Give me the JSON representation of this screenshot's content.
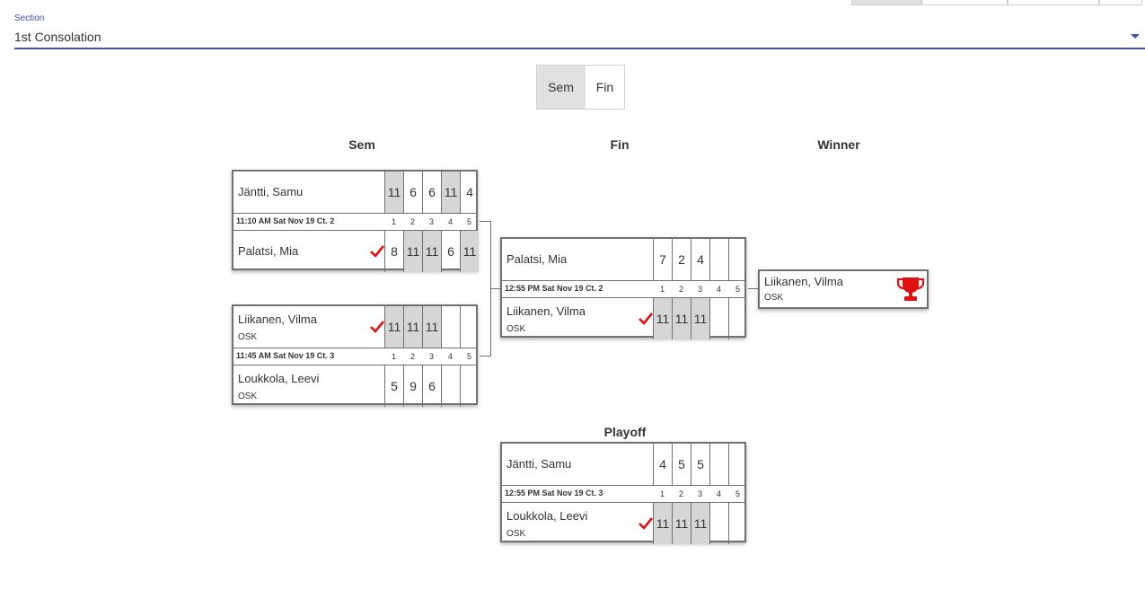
{
  "section": {
    "label": "Section",
    "value": "1st Consolation"
  },
  "round_toggle": [
    {
      "label": "Sem",
      "selected": true
    },
    {
      "label": "Fin",
      "selected": false
    }
  ],
  "headings": {
    "sem": "Sem",
    "fin": "Fin",
    "winner": "Winner",
    "playoff": "Playoff"
  },
  "game_numbers": [
    "1",
    "2",
    "3",
    "4",
    "5"
  ],
  "matches": {
    "sem1": {
      "time": "11:10 AM Sat Nov 19 Ct. 2",
      "p1": {
        "name": "Jäntti, Samu",
        "club": "",
        "won": false,
        "scores": [
          "11",
          "6",
          "6",
          "11",
          "4"
        ],
        "wins": [
          true,
          false,
          false,
          true,
          false
        ]
      },
      "p2": {
        "name": "Palatsi, Mia",
        "club": "",
        "won": true,
        "scores": [
          "8",
          "11",
          "11",
          "6",
          "11"
        ],
        "wins": [
          false,
          true,
          true,
          false,
          true
        ]
      }
    },
    "sem2": {
      "time": "11:45 AM Sat Nov 19 Ct. 3",
      "p1": {
        "name": "Liikanen, Vilma",
        "club": "OSK",
        "won": true,
        "scores": [
          "11",
          "11",
          "11",
          "",
          ""
        ],
        "wins": [
          true,
          true,
          true,
          false,
          false
        ]
      },
      "p2": {
        "name": "Loukkola, Leevi",
        "club": "OSK",
        "won": false,
        "scores": [
          "5",
          "9",
          "6",
          "",
          ""
        ],
        "wins": [
          false,
          false,
          false,
          false,
          false
        ]
      }
    },
    "final": {
      "time": "12:55 PM Sat Nov 19 Ct. 2",
      "p1": {
        "name": "Palatsi, Mia",
        "club": "",
        "won": false,
        "scores": [
          "7",
          "2",
          "4",
          "",
          ""
        ],
        "wins": [
          false,
          false,
          false,
          false,
          false
        ]
      },
      "p2": {
        "name": "Liikanen, Vilma",
        "club": "OSK",
        "won": true,
        "scores": [
          "11",
          "11",
          "11",
          "",
          ""
        ],
        "wins": [
          true,
          true,
          true,
          false,
          false
        ]
      }
    },
    "playoff": {
      "time": "12:55 PM Sat Nov 19 Ct. 3",
      "p1": {
        "name": "Jäntti, Samu",
        "club": "",
        "won": false,
        "scores": [
          "4",
          "5",
          "5",
          "",
          ""
        ],
        "wins": [
          false,
          false,
          false,
          false,
          false
        ]
      },
      "p2": {
        "name": "Loukkola, Leevi",
        "club": "OSK",
        "won": true,
        "scores": [
          "11",
          "11",
          "11",
          "",
          ""
        ],
        "wins": [
          true,
          true,
          true,
          false,
          false
        ]
      }
    }
  },
  "winner": {
    "name": "Liikanen, Vilma",
    "club": "OSK",
    "icon": "trophy-icon"
  },
  "colors": {
    "accent": "#3f51b5",
    "check": "#e01010",
    "trophy": "#e01010",
    "win_cell": "#d6d6d6",
    "border": "#707070"
  }
}
